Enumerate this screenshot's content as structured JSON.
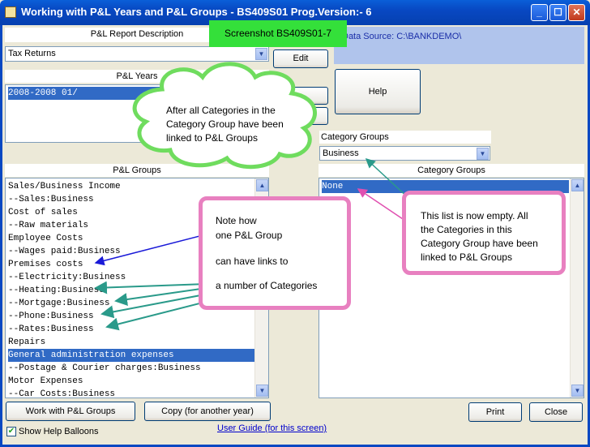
{
  "window": {
    "title": "Working with P&L Years and P&L Groups - BS409S01   Prog.Version:-  6"
  },
  "report": {
    "header": "P&L Report Description",
    "selected": "Tax Returns",
    "edit_label": "Edit"
  },
  "data_source": "Data Source: C:\\BANKDEMO\\",
  "screenshot_label": "Screenshot BS409S01-7",
  "years": {
    "header": "P&L Years",
    "rows": [
      "2008-2008             01/"
    ]
  },
  "help_label": "Help",
  "category_combo": {
    "header": "Category Groups",
    "selected": "Business"
  },
  "groups": {
    "header": "P&L Groups",
    "rows": [
      "Sales/Business Income",
      "--Sales:Business",
      "Cost of sales",
      "--Raw materials",
      "Employee Costs",
      "--Wages paid:Business",
      "Premises costs",
      "--Electricity:Business",
      "--Heating:Business",
      "--Mortgage:Business",
      "--Phone:Business",
      "--Rates:Business",
      "Repairs",
      "General administration expenses",
      "--Postage & Courier charges:Business",
      "Motor Expenses",
      "--Car Costs:Business"
    ],
    "selected_index": 13
  },
  "categories": {
    "header": "Category Groups",
    "rows": [
      "None"
    ]
  },
  "callouts": {
    "cloud": [
      "After all Categories in the",
      "Category Group have been",
      "linked to P&L Groups"
    ],
    "note": [
      "Note how",
      "one P&L Group",
      "can have links to",
      "a number of Categories"
    ],
    "empty": [
      "This list is now empty. All",
      "the Categories in this",
      "Category Group have been",
      "linked to P&L Groups"
    ]
  },
  "buttons": {
    "work_groups": "Work with P&L Groups",
    "copy_year": "Copy (for another year)",
    "print": "Print",
    "close": "Close"
  },
  "user_guide_link": "User Guide (for this screen)",
  "show_help_balloons": "Show Help Balloons",
  "colors": {
    "selection": "#316ac5",
    "titlebar": "#0848c2",
    "callout_border": "#e880c0",
    "cloud_border": "#6fdc5e",
    "arrow_blue": "#1a1ad8",
    "arrow_teal": "#2a9a8a"
  }
}
